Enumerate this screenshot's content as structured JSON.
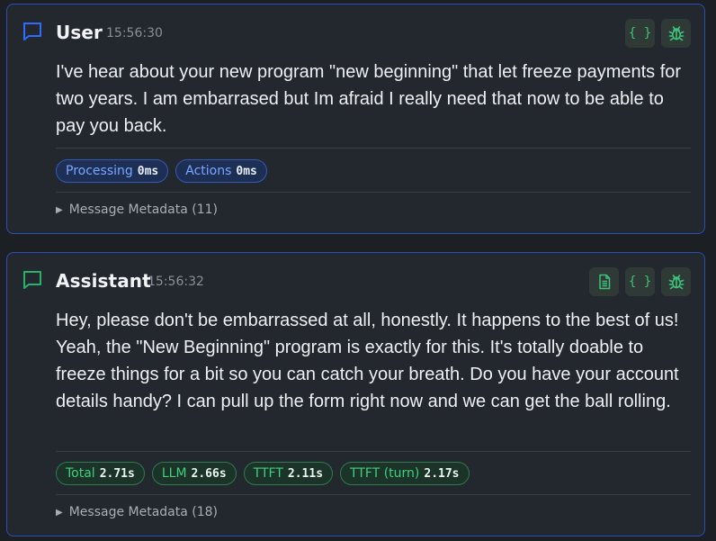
{
  "messages": [
    {
      "role": "User",
      "time": "15:56:30",
      "text": "I've hear about your new program \"new beginning\" that let freeze payments for two years. I am embarrased but Im afraid I really need that now to be able to pay you back.",
      "chips": [
        {
          "label": "Processing",
          "value": "0ms"
        },
        {
          "label": "Actions",
          "value": "0ms"
        }
      ],
      "metadata_label": "Message Metadata (11)",
      "icon_color": "#2f6bff",
      "tools": [
        "json-icon",
        "debug-icon"
      ]
    },
    {
      "role": "Assistant",
      "time": "15:56:32",
      "text": "Hey, please don't be embarrassed at all, honestly. It happens to the best of us! Yeah, the \"New Beginning\" program is exactly for this. It's totally doable to freeze things for a bit so you can catch your breath. Do you have your account details handy? I can pull up the form right now and we can get the ball rolling.",
      "chips": [
        {
          "label": "Total",
          "value": "2.71s"
        },
        {
          "label": "LLM",
          "value": "2.66s"
        },
        {
          "label": "TTFT",
          "value": "2.11s"
        },
        {
          "label": "TTFT (turn)",
          "value": "2.17s"
        }
      ],
      "metadata_label": "Message Metadata (18)",
      "icon_color": "#27b36a",
      "tools": [
        "document-icon",
        "json-icon",
        "debug-icon"
      ]
    }
  ],
  "tool_glyphs": {
    "json": "{ }"
  },
  "colors": {
    "accent_blue": "#2a4fb8",
    "accent_green": "#3ec27a",
    "background": "#1c1f24",
    "card": "#23272e"
  }
}
